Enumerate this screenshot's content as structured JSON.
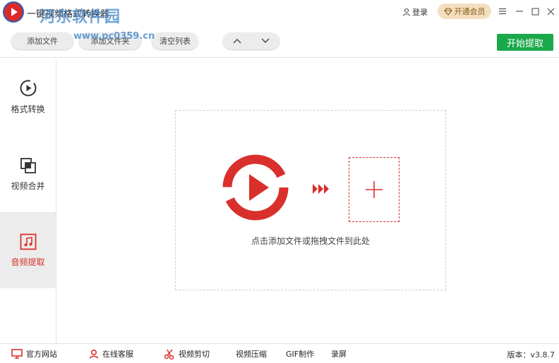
{
  "window": {
    "title": "一键视频格式转换器",
    "watermark": "河东软件园",
    "watermark_url": "www.pc0359.cn",
    "login_label": "登录",
    "vip_label": "开通会员"
  },
  "toolbar": {
    "add_file_label": "添加文件",
    "add_folder_label": "添加文件夹",
    "clear_list_label": "清空列表",
    "start_label": "开始提取"
  },
  "sidebar": {
    "items": [
      {
        "label": "格式转换",
        "icon": "play-circle-icon",
        "active": false
      },
      {
        "label": "视频合并",
        "icon": "merge-icon",
        "active": false
      },
      {
        "label": "音频提取",
        "icon": "music-note-icon",
        "active": true
      }
    ]
  },
  "main": {
    "drop_hint": "点击添加文件或拖拽文件到此处"
  },
  "statusbar": {
    "items": [
      {
        "label": "官方网站",
        "icon": "monitor-icon"
      },
      {
        "label": "在线客服",
        "icon": "user-icon"
      },
      {
        "label": "视频剪切",
        "icon": "scissors-icon"
      },
      {
        "label": "视频压缩",
        "icon": ""
      },
      {
        "label": "GIF制作",
        "icon": ""
      },
      {
        "label": "录屏",
        "icon": ""
      }
    ],
    "version": "版本：v3.8.7"
  },
  "colors": {
    "accent": "#d9302c",
    "start_button": "#1aa84a",
    "vip_bg": "#f3dfbf"
  }
}
